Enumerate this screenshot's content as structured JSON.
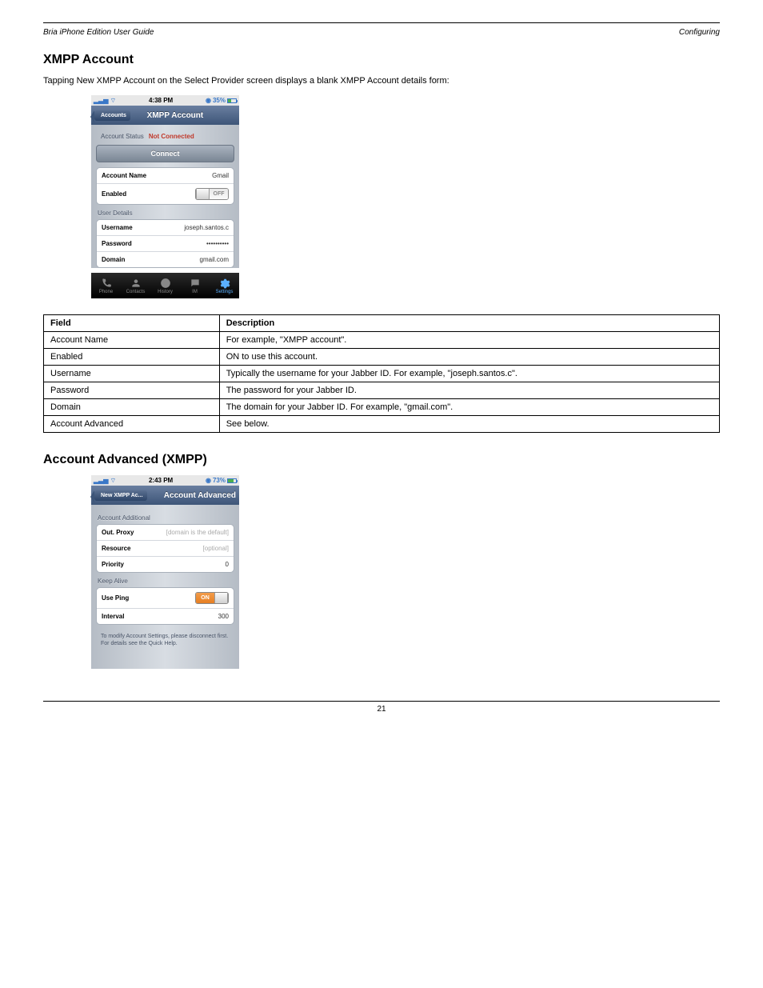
{
  "header": {
    "left": "Bria iPhone Edition User Guide",
    "right": "Configuring"
  },
  "section1": {
    "title": "XMPP Account",
    "intro": "Tapping New XMPP Account on the Select Provider screen displays a blank XMPP Account details form:"
  },
  "phone1": {
    "status": {
      "time": "4:38 PM",
      "battery": "35%"
    },
    "nav": {
      "back": "Accounts",
      "title": "XMPP Account"
    },
    "accountStatus": {
      "label": "Account Status",
      "value": "Not Connected"
    },
    "connect": "Connect",
    "rows": {
      "accountName": {
        "label": "Account Name",
        "value": "Gmail"
      },
      "enabled": {
        "label": "Enabled",
        "toggle": "OFF"
      }
    },
    "userDetails": "User Details",
    "rows2": {
      "username": {
        "label": "Username",
        "value": "joseph.santos.c"
      },
      "password": {
        "label": "Password",
        "value": "••••••••••"
      },
      "domain": {
        "label": "Domain",
        "value": "gmail.com"
      }
    },
    "tabs": [
      "Phone",
      "Contacts",
      "History",
      "IM",
      "Settings"
    ]
  },
  "table1": {
    "headers": [
      "Field",
      "Description"
    ],
    "rows": [
      {
        "field": "Account Name",
        "desc": "For example, \"XMPP account\"."
      },
      {
        "field": "Enabled",
        "desc": "ON to use this account."
      },
      {
        "field": "Username",
        "desc": "Typically the username for your Jabber ID. For example, \"joseph.santos.c\"."
      },
      {
        "field": "Password",
        "desc": "The password for your Jabber ID."
      },
      {
        "field": "Domain",
        "desc": "The domain for your Jabber ID. For example, \"gmail.com\"."
      },
      {
        "field": "Account Advanced",
        "desc": "See below."
      }
    ]
  },
  "section2": {
    "title": "Account Advanced (XMPP)"
  },
  "phone2": {
    "status": {
      "time": "2:43 PM",
      "battery": "73%"
    },
    "nav": {
      "back": "New XMPP Ac...",
      "title": "Account Advanced"
    },
    "sectionA": "Account Additional",
    "rowsA": {
      "outProxy": {
        "label": "Out. Proxy",
        "placeholder": "[domain is the default]"
      },
      "resource": {
        "label": "Resource",
        "placeholder": "[optional]"
      },
      "priority": {
        "label": "Priority",
        "value": "0"
      }
    },
    "sectionB": "Keep Alive",
    "rowsB": {
      "usePing": {
        "label": "Use Ping",
        "toggle": "ON"
      },
      "interval": {
        "label": "Interval",
        "value": "300"
      }
    },
    "note": "To modify Account Settings, please disconnect first.  For details see the Quick Help."
  },
  "footer": "21"
}
